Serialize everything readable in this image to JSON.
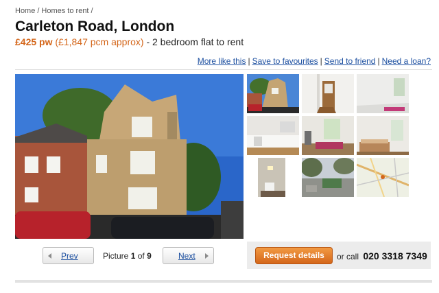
{
  "breadcrumb": {
    "items": [
      "Home",
      "Homes to rent"
    ],
    "separator": "/"
  },
  "listing": {
    "title": "Carleton Road, London",
    "price": "£425 pw",
    "pcm": "(£1,847 pcm approx)",
    "description": " - 2 bedroom flat to rent"
  },
  "actions": {
    "more_like_this": "More like this",
    "save": "Save to favourites",
    "send": "Send to friend",
    "loan": "Need a loan?",
    "separator": "|"
  },
  "gallery": {
    "main_photo": "house-exterior-photo",
    "thumbnails": [
      "house-exterior-thumb",
      "hallway-thumb",
      "bedroom-empty-thumb",
      "kitchen-thumb",
      "living-room-thumb",
      "bedroom-bed-thumb",
      "bathroom-thumb",
      "garden-thumb",
      "map-thumb"
    ]
  },
  "pager": {
    "prev_label": "Prev",
    "next_label": "Next",
    "picture_word": "Picture",
    "current": "1",
    "of_word": "of",
    "total": "9"
  },
  "contact": {
    "request_label": "Request details",
    "or_call": "or call",
    "phone": "020 3318 7349"
  },
  "colors": {
    "accent_orange": "#d4661a",
    "link_blue": "#1c4fa0"
  }
}
